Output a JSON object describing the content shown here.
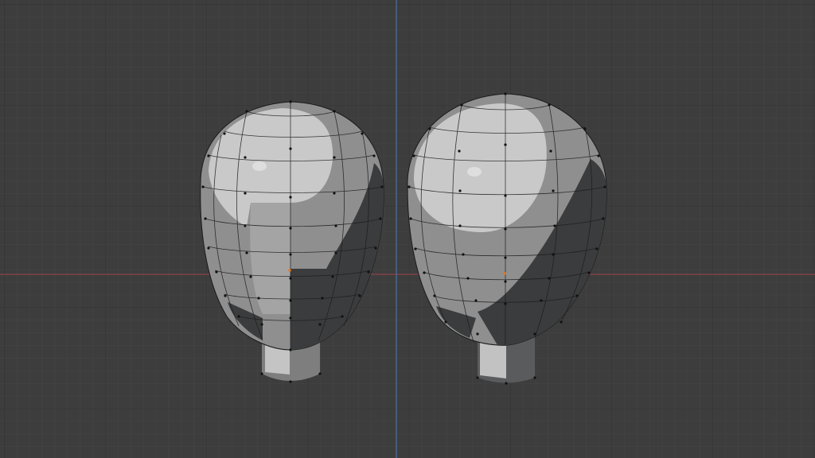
{
  "viewport": {
    "name": "3D Viewport",
    "background_color": "#3d3d3d",
    "grid_minor_color": "#444444",
    "grid_major_color": "#2f2f2f",
    "axis_x_color": "#a3434b",
    "axis_y_color": "#4e7ab5",
    "show_grid": true
  },
  "scene": {
    "objects": [
      {
        "name": "head-mesh-left",
        "shading": "solid",
        "wireframe": true,
        "base_color": "#8e8e8e",
        "highlight_color": "#c8c8c8",
        "shadow_color": "#3a3b3c"
      },
      {
        "name": "head-mesh-right",
        "shading": "solid",
        "wireframe": true,
        "base_color": "#8e8e8e",
        "highlight_color": "#c8c8c8",
        "shadow_color": "#3a3b3c"
      }
    ],
    "vertex_color": "#111111",
    "origin_color": "#e07a1f"
  }
}
